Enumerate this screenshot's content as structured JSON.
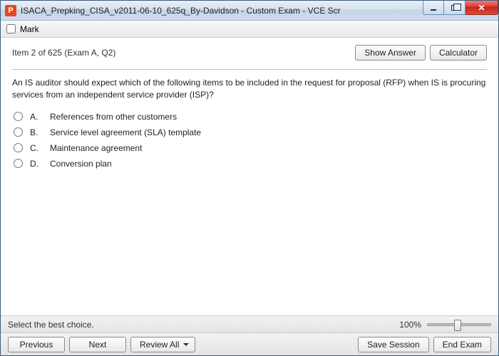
{
  "window": {
    "title": "ISACA_Prepking_CISA_v2011-06-10_625q_By-Davidson - Custom Exam - VCE Scr",
    "appicon_letter": "P"
  },
  "markbar": {
    "label": "Mark",
    "checked": false
  },
  "item": {
    "counter": "Item 2 of 625  (Exam A, Q2)",
    "show_answer": "Show Answer",
    "calculator": "Calculator",
    "question": "An IS auditor should expect which of the following items to be included in the request for proposal (RFP) when IS is procuring services from an independent service provider (ISP)?",
    "options": [
      {
        "letter": "A.",
        "text": "References from other customers"
      },
      {
        "letter": "B.",
        "text": "Service level agreement (SLA) template"
      },
      {
        "letter": "C.",
        "text": "Maintenance agreement"
      },
      {
        "letter": "D.",
        "text": "Conversion plan"
      }
    ]
  },
  "status": {
    "hint": "Select the best choice.",
    "zoom": "100%"
  },
  "footer": {
    "previous": "Previous",
    "next": "Next",
    "review_all": "Review All",
    "save_session": "Save Session",
    "end_exam": "End Exam"
  }
}
